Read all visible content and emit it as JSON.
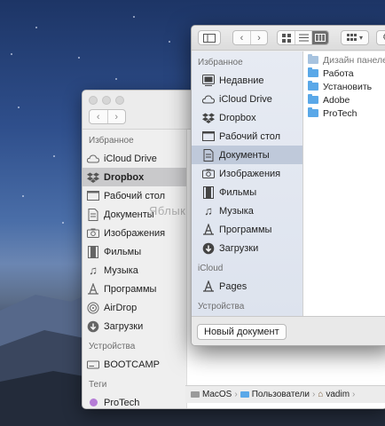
{
  "back_window": {
    "sections": [
      {
        "title": "Избранное",
        "items": [
          {
            "label": "iCloud Drive",
            "icon": "cloud-icon"
          },
          {
            "label": "Dropbox",
            "icon": "dropbox-icon",
            "selected": true
          },
          {
            "label": "Рабочий стол",
            "icon": "desktop-icon"
          },
          {
            "label": "Документы",
            "icon": "document-icon"
          },
          {
            "label": "Изображения",
            "icon": "camera-icon"
          },
          {
            "label": "Фильмы",
            "icon": "film-icon"
          },
          {
            "label": "Музыка",
            "icon": "music-icon"
          },
          {
            "label": "Программы",
            "icon": "applications-icon"
          },
          {
            "label": "AirDrop",
            "icon": "airdrop-icon"
          },
          {
            "label": "Загрузки",
            "icon": "download-icon"
          }
        ]
      },
      {
        "title": "Устройства",
        "items": [
          {
            "label": "BOOTCAMP",
            "icon": "disk-icon"
          }
        ]
      },
      {
        "title": "Теги",
        "items": [
          {
            "label": "ProTech",
            "icon": "tag-purple-icon"
          }
        ]
      }
    ],
    "path": [
      "MacOS",
      "Пользователи",
      "vadim"
    ]
  },
  "front_window": {
    "sidebar_title": "Избранное",
    "favorites": [
      {
        "label": "Недавние",
        "icon": "recents-icon"
      },
      {
        "label": "iCloud Drive",
        "icon": "cloud-icon"
      },
      {
        "label": "Dropbox",
        "icon": "dropbox-icon"
      },
      {
        "label": "Рабочий стол",
        "icon": "desktop-icon"
      },
      {
        "label": "Документы",
        "icon": "document-icon",
        "selected": true
      },
      {
        "label": "Изображения",
        "icon": "camera-icon"
      },
      {
        "label": "Фильмы",
        "icon": "film-icon"
      },
      {
        "label": "Музыка",
        "icon": "music-icon"
      },
      {
        "label": "Программы",
        "icon": "applications-icon"
      },
      {
        "label": "Загрузки",
        "icon": "download-icon"
      }
    ],
    "icloud_title": "iCloud",
    "icloud_items": [
      {
        "label": "Pages",
        "icon": "pages-icon"
      }
    ],
    "devices_title": "Устройства",
    "files": [
      {
        "name": "Дизайн панелей",
        "dim": true
      },
      {
        "name": "Работа"
      },
      {
        "name": "Установить"
      },
      {
        "name": "Adobe"
      },
      {
        "name": "ProTech"
      }
    ],
    "new_document_label": "Новый документ"
  },
  "watermark": "Яблык",
  "colors": {
    "selection": "#bfc9da",
    "folder": "#5aa8e8",
    "tag_purple": "#b57cd6"
  }
}
